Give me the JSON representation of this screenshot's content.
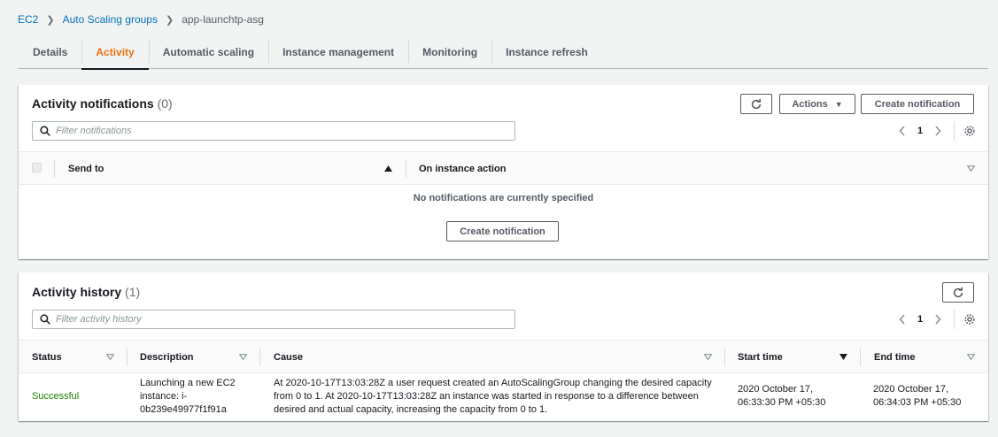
{
  "breadcrumb": {
    "root": "EC2",
    "section": "Auto Scaling groups",
    "current": "app-launchtp-asg"
  },
  "tabs": [
    {
      "label": "Details"
    },
    {
      "label": "Activity",
      "active": true
    },
    {
      "label": "Automatic scaling"
    },
    {
      "label": "Instance management"
    },
    {
      "label": "Monitoring"
    },
    {
      "label": "Instance refresh"
    }
  ],
  "notifications": {
    "title": "Activity notifications",
    "count": "(0)",
    "actions_label": "Actions",
    "create_label": "Create notification",
    "filter_placeholder": "Filter notifications",
    "page": "1",
    "columns": {
      "send_to": "Send to",
      "on_instance_action": "On instance action"
    },
    "empty_message": "No notifications are currently specified",
    "empty_create_label": "Create notification"
  },
  "history": {
    "title": "Activity history",
    "count": "(1)",
    "filter_placeholder": "Filter activity history",
    "page": "1",
    "columns": {
      "status": "Status",
      "description": "Description",
      "cause": "Cause",
      "start_time": "Start time",
      "end_time": "End time"
    },
    "rows": [
      {
        "status": "Successful",
        "description": "Launching a new EC2 instance: i-0b239e49977f1f91a",
        "cause": "At 2020-10-17T13:03:28Z a user request created an AutoScalingGroup changing the desired capacity from 0 to 1. At 2020-10-17T13:03:28Z an instance was started in response to a difference between desired and actual capacity, increasing the capacity from 0 to 1.",
        "start_time": "2020 October 17, 06:33:30 PM +05:30",
        "end_time": "2020 October 17, 06:34:03 PM +05:30"
      }
    ]
  },
  "colors": {
    "link": "#0073bb",
    "active_tab": "#ec7211",
    "success": "#1d8102"
  }
}
